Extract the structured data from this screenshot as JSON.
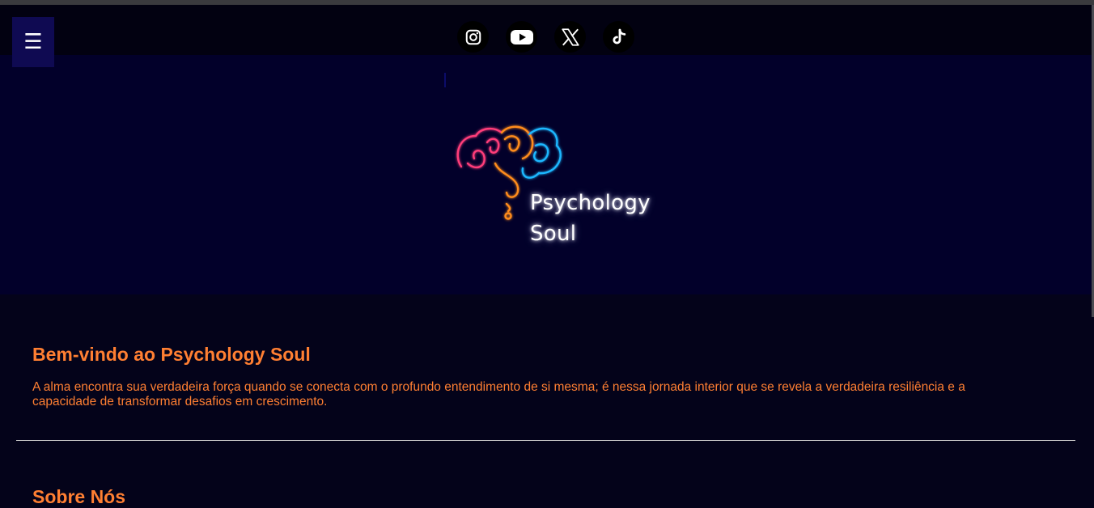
{
  "colors": {
    "page_background": "#04031a",
    "hero_background": "#02002a",
    "menu_button": "#0f0a52",
    "accent_orange": "#ff7f32",
    "divider": "#c9c9c9"
  },
  "header": {
    "menu_icon": "☰",
    "social_links": [
      {
        "icon": "instagram-icon"
      },
      {
        "icon": "youtube-icon"
      },
      {
        "icon": "x-icon"
      },
      {
        "icon": "tiktok-icon"
      }
    ]
  },
  "hero": {
    "logo_line1": "Psychology",
    "logo_line2": "Soul"
  },
  "welcome": {
    "title": "Bem-vindo ao Psychology Soul",
    "text": "A alma encontra sua verdadeira força quando se conecta com o profundo entendimento de si mesma; é nessa jornada interior que se revela a verdadeira resiliência e a capacidade de transformar desafios em crescimento."
  },
  "next_section": {
    "title": "Sobre Nós"
  }
}
